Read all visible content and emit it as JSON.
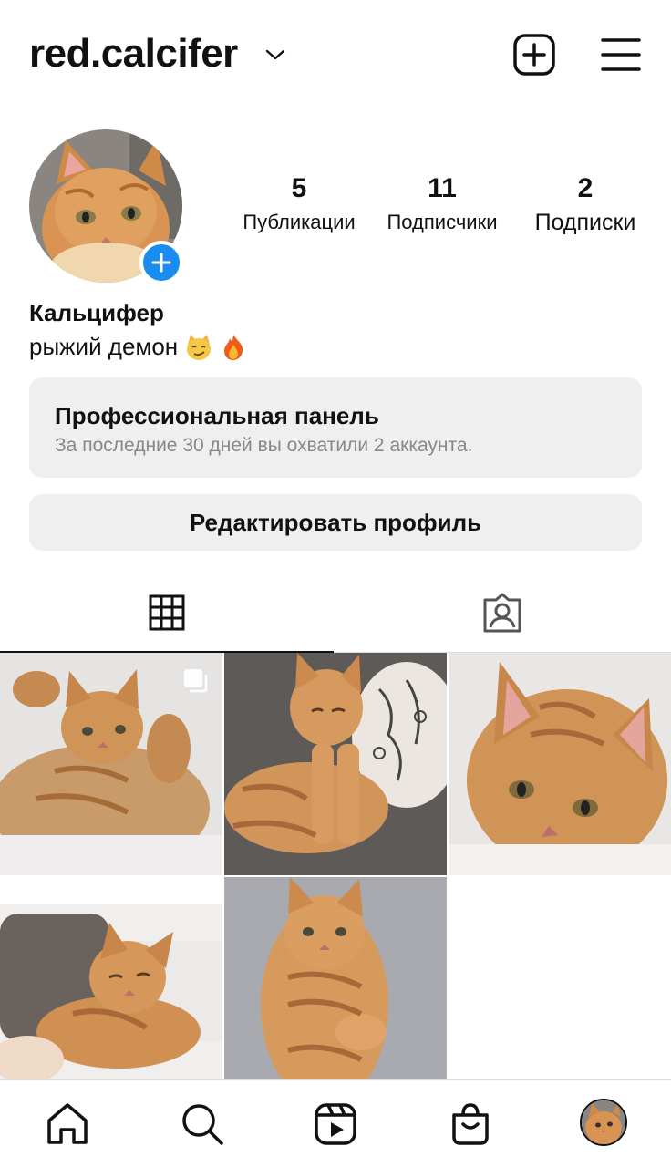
{
  "header": {
    "username": "red.calcifer",
    "icons": {
      "switch_account": "chevron-down-icon",
      "new_post": "plus-square-icon",
      "menu": "hamburger-menu-icon"
    }
  },
  "profile": {
    "display_name": "Кальцифер",
    "bio_text": "рыжий демон",
    "bio_emojis": [
      "smirking-cat-emoji",
      "fire-emoji"
    ],
    "stats": [
      {
        "value": "5",
        "label": "Публикации"
      },
      {
        "value": "11",
        "label": "Подписчики"
      },
      {
        "value": "2",
        "label": "Подписки"
      }
    ]
  },
  "professional_panel": {
    "title": "Профессиональная панель",
    "subtitle": "За последние 30 дней вы охватили 2 аккаунта."
  },
  "edit_profile_label": "Редактировать профиль",
  "tabs": [
    {
      "icon": "grid-icon",
      "active": true
    },
    {
      "icon": "tagged-person-icon",
      "active": false
    }
  ],
  "posts": [
    {
      "description": "ginger kitten lying on its back, paws raised",
      "multiple": true
    },
    {
      "description": "ginger kitten sitting on grey sofa by patterned pillow",
      "multiple": false
    },
    {
      "description": "ginger kitten close-up on white blanket",
      "multiple": false
    },
    {
      "description": "ginger kitten sleeping on bed",
      "multiple": false
    },
    {
      "description": "ginger kitten lying on lap",
      "multiple": false
    }
  ],
  "bottom_nav": [
    "home-icon",
    "search-icon",
    "reels-icon",
    "shop-icon",
    "profile-avatar"
  ],
  "colors": {
    "accent": "#1a8cf0",
    "panel_bg": "#efefef",
    "secondary_text": "#888888",
    "cat_orange": "#d9904a"
  }
}
